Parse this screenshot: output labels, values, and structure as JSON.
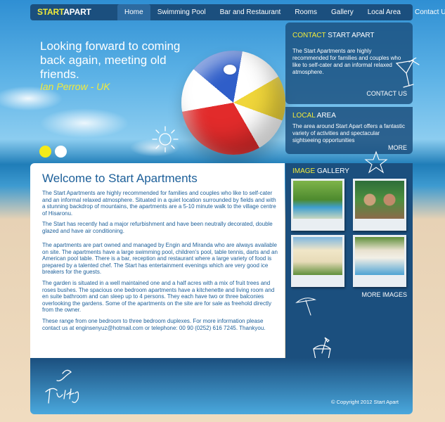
{
  "brand": {
    "part1": "START",
    "part2": "APART"
  },
  "nav": {
    "items": [
      {
        "label": "Home",
        "active": true
      },
      {
        "label": "Swimming Pool"
      },
      {
        "label": "Bar and Restaurant"
      },
      {
        "label": "Rooms"
      },
      {
        "label": "Gallery"
      },
      {
        "label": "Local Area"
      },
      {
        "label": "Contact Us"
      }
    ]
  },
  "hero": {
    "quote": "Looking forward to coming back again, meeting old friends.",
    "author": "Ian Perrow - UK"
  },
  "contact_panel": {
    "title_highlight": "CONTACT",
    "title_rest": " START APART",
    "body": "The Start Apartments are highly recommended for families and couples who like to self-cater and an informal relaxed atmosphere.",
    "link": "CONTACT US"
  },
  "local_panel": {
    "title_highlight": "LOCAL",
    "title_rest": " AREA",
    "body": "The area around Start Apart offers a fantastic variety of activities and spectacular sightseeing opportunities",
    "link": "MORE"
  },
  "gallery": {
    "title_highlight": "IMAGE",
    "title_rest": " GALLERY",
    "link": "MORE IMAGES"
  },
  "main": {
    "title": "Welcome to Start Apartments",
    "paragraphs": [
      "The Start Apartments are highly recommended for families and couples who like to self-cater and an informal relaxed atmosphere. Situated in a quiet location surrounded by fields and with a stunning backdrop of mountains, the apartments are a 5-10 minute walk to the village centre of Hisaronu.",
      "The Start has recently had a major refurbishment and have been neutrally decorated, double glazed and have air conditioning.",
      "The apartments are part owned and managed by Engin and Miranda who are always available on site. The apartments have a large swimming pool, children's pool, table tennis, darts and an American pool table. There is a bar, reception and restaurant where a large variety of food is prepared by a talented chef. The Start has entertainment evenings which are very good ice breakers for the guests.",
      "The garden is situated in a well maintained one and a half acres with a mix of fruit trees and roses bushes. The spacious one bedroom apartments have a kitchenette and living room and en suite bathroom and can sleep up to 4 persons. They each have two or three balconies overlooking the gardens. Some of the apartments on the site are for sale as freehold directly from the owner.",
      "These range from one bedroom to three bedroom duplexes. For more information please contact us at enginsenyuz@hotmail.com or telephone: 00 90 (0252) 616 7245. Thankyou."
    ]
  },
  "footer": {
    "logo_text": "Turkey",
    "copyright": "© Copyright 2012 Start Apart"
  },
  "colors": {
    "nav_bg": "#1b4f7e",
    "accent_yellow": "#f2ea3a",
    "text_blue": "#1c5f99"
  }
}
